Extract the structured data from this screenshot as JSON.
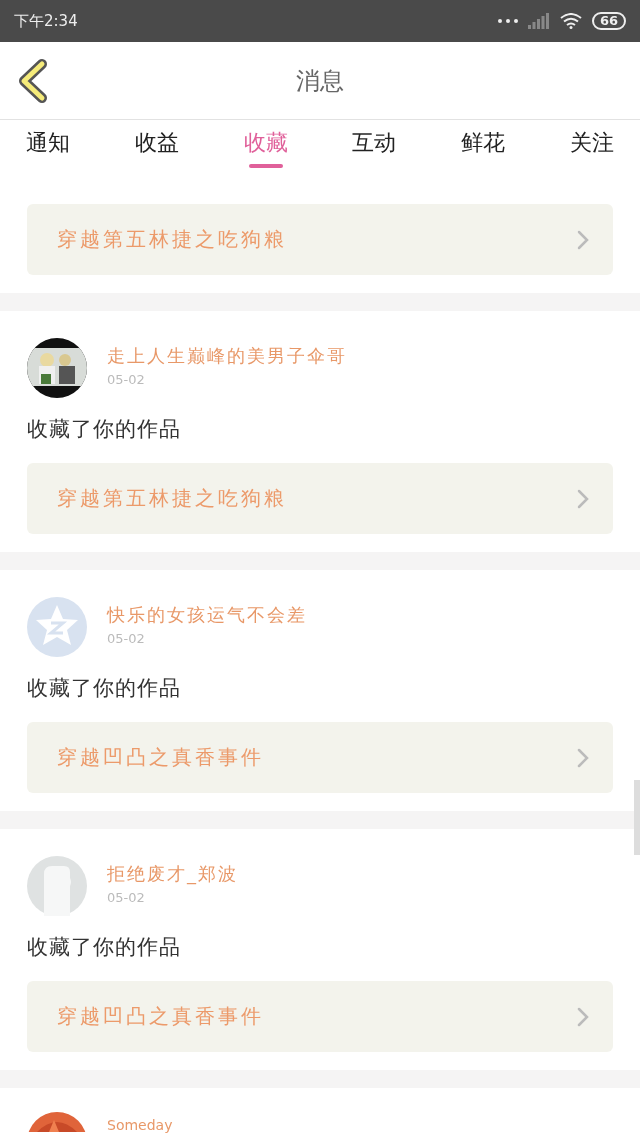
{
  "status_bar": {
    "time": "下午2:34",
    "battery": "66"
  },
  "header": {
    "title": "消息"
  },
  "tabs": [
    {
      "label": "通知",
      "selected": false
    },
    {
      "label": "收益",
      "selected": false
    },
    {
      "label": "收藏",
      "selected": true
    },
    {
      "label": "互动",
      "selected": false
    },
    {
      "label": "鲜花",
      "selected": false
    },
    {
      "label": "关注",
      "selected": false
    }
  ],
  "first_item": {
    "work": "穿越第五林捷之吃狗粮"
  },
  "items": [
    {
      "name": "走上人生巅峰的美男子伞哥",
      "date": "05-02",
      "action": "收藏了你的作品",
      "work": "穿越第五林捷之吃狗粮"
    },
    {
      "avatar": {
        "kind": "star"
      },
      "name": "快乐的女孩运气不会差",
      "date": "05-02",
      "action": "收藏了你的作品",
      "work": "穿越凹凸之真香事件"
    },
    {
      "avatar": {
        "kind": "silhouette"
      },
      "name": "拒绝废才_郑波",
      "date": "05-02",
      "action": "收藏了你的作品",
      "work": "穿越凹凸之真香事件"
    }
  ],
  "last_item": {
    "avatar": {
      "kind": "photo_orange"
    },
    "name": "Someday"
  }
}
